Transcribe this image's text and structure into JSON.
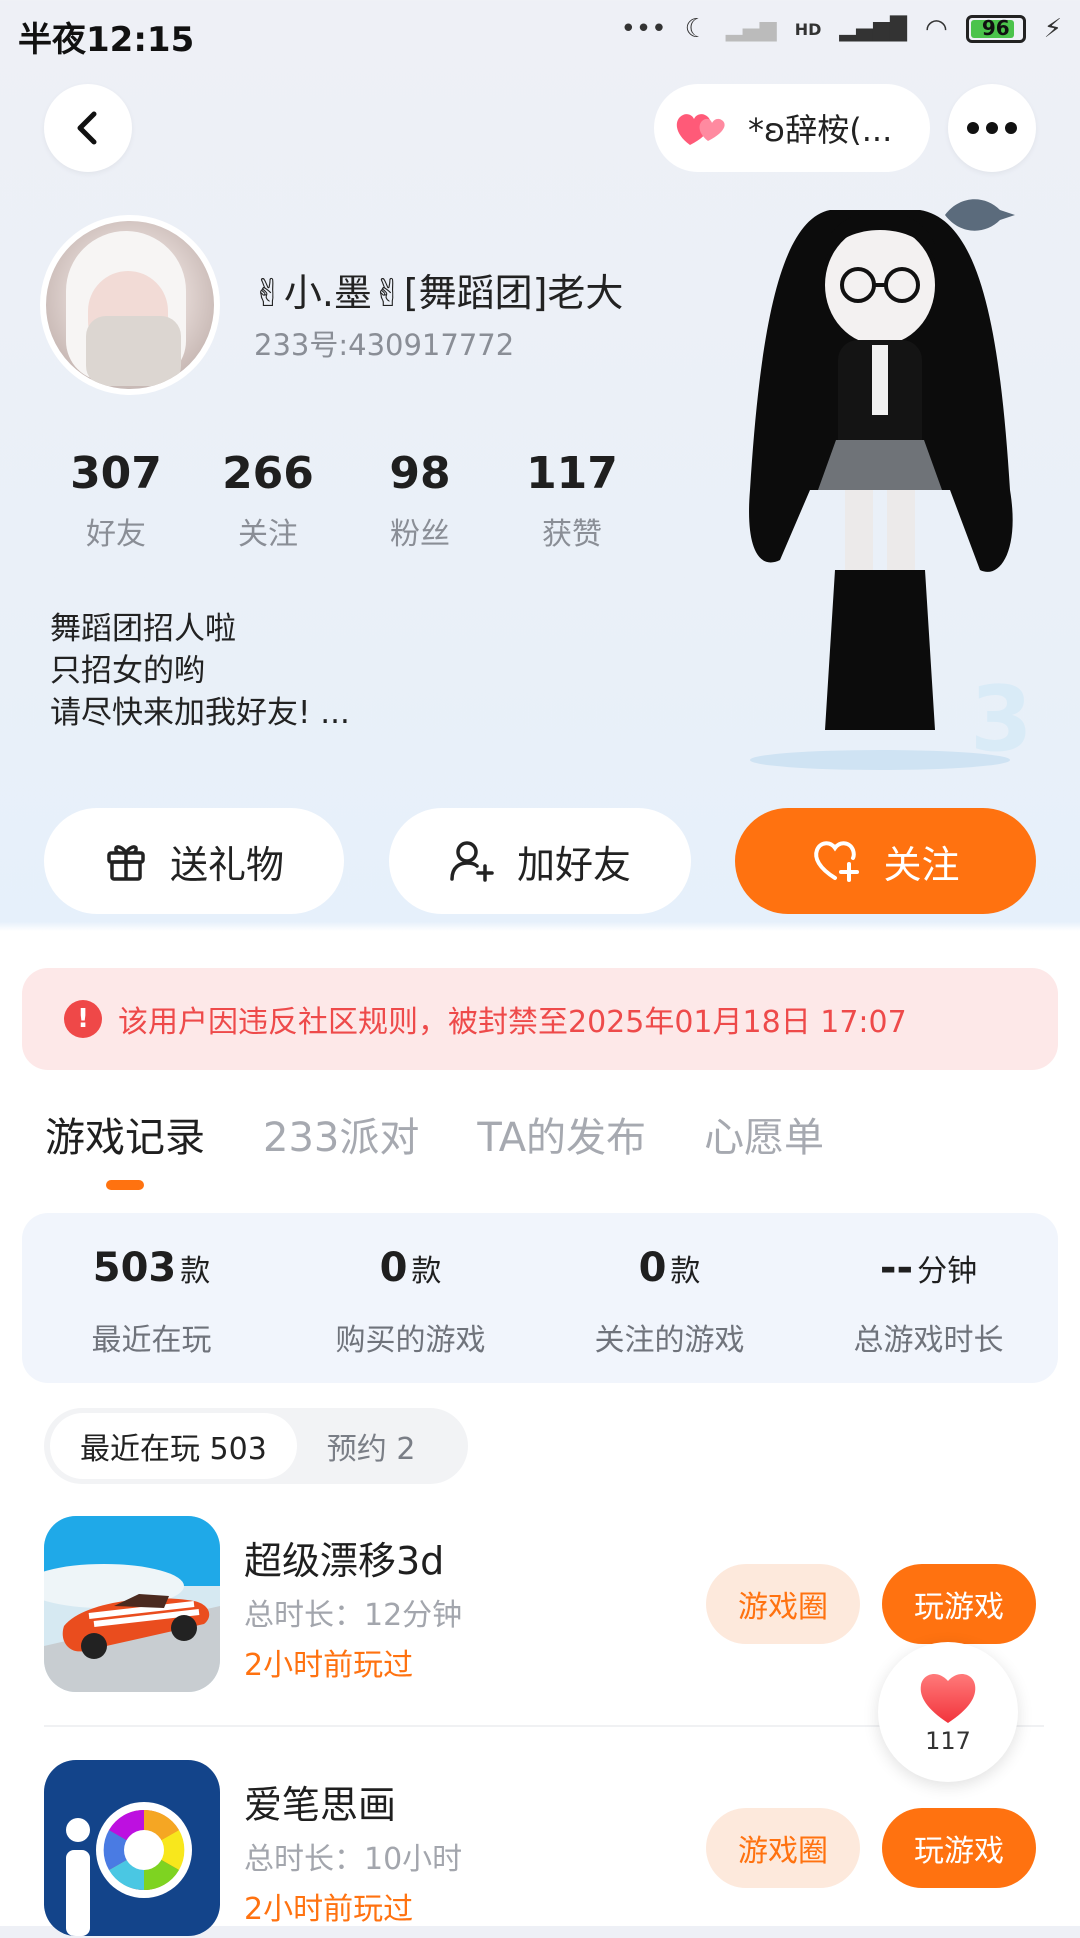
{
  "status_bar": {
    "time": "半夜12:15",
    "network": "HD",
    "battery": "96"
  },
  "header": {
    "room_name": "*ʚ辞桉(..."
  },
  "profile": {
    "name": "✌小.墨✌[舞蹈团]老大",
    "uid": "233号:430917772",
    "stats": [
      {
        "value": "307",
        "label": "好友"
      },
      {
        "value": "266",
        "label": "关注"
      },
      {
        "value": "98",
        "label": "粉丝"
      },
      {
        "value": "117",
        "label": "获赞"
      }
    ],
    "bio": [
      "舞蹈团招人啦",
      "只招女的哟",
      "请尽快来加我好友! ..."
    ]
  },
  "actions": {
    "gift": "送礼物",
    "add_friend": "加好友",
    "follow": "关注"
  },
  "ban_notice": "该用户因违反社区规则，被封禁至2025年01月18日 17:07",
  "tabs": [
    "游戏记录",
    "233派对",
    "TA的发布",
    "心愿单"
  ],
  "summary": [
    {
      "value": "503",
      "unit": "款",
      "label": "最近在玩"
    },
    {
      "value": "0",
      "unit": "款",
      "label": "购买的游戏"
    },
    {
      "value": "0",
      "unit": "款",
      "label": "关注的游戏"
    },
    {
      "value": "--",
      "unit": "分钟",
      "label": "总游戏时长"
    }
  ],
  "segments": {
    "recent": "最近在玩 503",
    "reserve": "预约 2"
  },
  "games": [
    {
      "title": "超级漂移3d",
      "duration": "总时长：12分钟",
      "last_played": "2小时前玩过",
      "circle_label": "游戏圈",
      "play_label": "玩游戏"
    },
    {
      "title": "爱笔思画",
      "duration": "总时长：10小时",
      "last_played": "2小时前玩过",
      "circle_label": "游戏圈",
      "play_label": "玩游戏"
    }
  ],
  "like_float": {
    "count": "117"
  },
  "colors": {
    "accent": "#ff7210",
    "ban_text": "#ee4a4a",
    "ban_bg": "#fde8e8"
  }
}
